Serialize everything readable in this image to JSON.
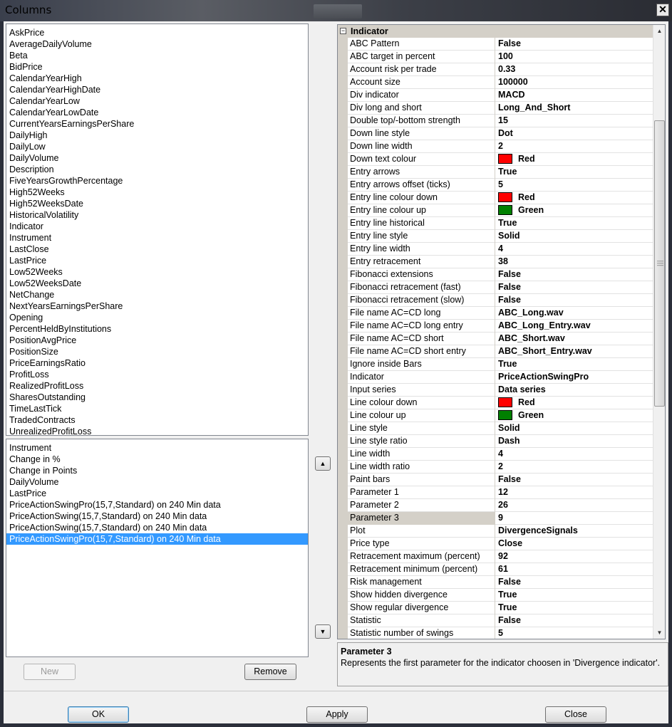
{
  "window": {
    "title": "Columns",
    "close_glyph": "✕"
  },
  "available_columns": [
    "AskPrice",
    "AverageDailyVolume",
    "Beta",
    "BidPrice",
    "CalendarYearHigh",
    "CalendarYearHighDate",
    "CalendarYearLow",
    "CalendarYearLowDate",
    "CurrentYearsEarningsPerShare",
    "DailyHigh",
    "DailyLow",
    "DailyVolume",
    "Description",
    "FiveYearsGrowthPercentage",
    "High52Weeks",
    "High52WeeksDate",
    "HistoricalVolatility",
    "Indicator",
    "Instrument",
    "LastClose",
    "LastPrice",
    "Low52Weeks",
    "Low52WeeksDate",
    "NetChange",
    "NextYearsEarningsPerShare",
    "Opening",
    "PercentHeldByInstitutions",
    "PositionAvgPrice",
    "PositionSize",
    "PriceEarningsRatio",
    "ProfitLoss",
    "RealizedProfitLoss",
    "SharesOutstanding",
    "TimeLastTick",
    "TradedContracts",
    "UnrealizedProfitLoss"
  ],
  "selected_columns": [
    "Instrument",
    "Change in %",
    "Change in Points",
    "DailyVolume",
    "LastPrice",
    "PriceActionSwingPro(15,7,Standard) on 240 Min data",
    "PriceActionSwing(15,7,Standard) on 240 Min data",
    "PriceActionSwing(15,7,Standard) on 240 Min data",
    "PriceActionSwingPro(15,7,Standard) on 240 Min data"
  ],
  "selected_index": 8,
  "buttons": {
    "new": "New",
    "remove": "Remove",
    "ok": "OK",
    "apply": "Apply",
    "close": "Close",
    "move_up": "▲",
    "move_down": "▼"
  },
  "property_grid": {
    "category": "Indicator",
    "collapse_glyph": "−",
    "selected_row": 37,
    "rows": [
      {
        "name": "ABC Pattern",
        "value": "False"
      },
      {
        "name": "ABC target in percent",
        "value": "100"
      },
      {
        "name": "Account risk per trade",
        "value": "0.33"
      },
      {
        "name": "Account size",
        "value": "100000"
      },
      {
        "name": "Div indicator",
        "value": "MACD"
      },
      {
        "name": "Div long and short",
        "value": "Long_And_Short"
      },
      {
        "name": "Double top/-bottom strength",
        "value": "15"
      },
      {
        "name": "Down line style",
        "value": "Dot"
      },
      {
        "name": "Down line width",
        "value": "2"
      },
      {
        "name": "Down text colour",
        "value": "Red",
        "swatch": "#ff0000"
      },
      {
        "name": "Entry arrows",
        "value": "True"
      },
      {
        "name": "Entry arrows offset (ticks)",
        "value": "5"
      },
      {
        "name": "Entry line colour down",
        "value": "Red",
        "swatch": "#ff0000"
      },
      {
        "name": "Entry line colour up",
        "value": "Green",
        "swatch": "#008000"
      },
      {
        "name": "Entry line historical",
        "value": "True"
      },
      {
        "name": "Entry line style",
        "value": "Solid"
      },
      {
        "name": "Entry line width",
        "value": "4"
      },
      {
        "name": "Entry retracement",
        "value": "38"
      },
      {
        "name": "Fibonacci extensions",
        "value": "False"
      },
      {
        "name": "Fibonacci retracement (fast)",
        "value": "False"
      },
      {
        "name": "Fibonacci retracement (slow)",
        "value": "False"
      },
      {
        "name": "File name AC=CD long",
        "value": "ABC_Long.wav"
      },
      {
        "name": "File name AC=CD long entry",
        "value": "ABC_Long_Entry.wav"
      },
      {
        "name": "File name AC=CD short",
        "value": "ABC_Short.wav"
      },
      {
        "name": "File name AC=CD short entry",
        "value": "ABC_Short_Entry.wav"
      },
      {
        "name": "Ignore inside Bars",
        "value": "True"
      },
      {
        "name": "Indicator",
        "value": "PriceActionSwingPro"
      },
      {
        "name": "Input series",
        "value": "Data series"
      },
      {
        "name": "Line colour down",
        "value": "Red",
        "swatch": "#ff0000"
      },
      {
        "name": "Line colour up",
        "value": "Green",
        "swatch": "#008000"
      },
      {
        "name": "Line style",
        "value": "Solid"
      },
      {
        "name": "Line style ratio",
        "value": "Dash"
      },
      {
        "name": "Line width",
        "value": "4"
      },
      {
        "name": "Line width ratio",
        "value": "2"
      },
      {
        "name": "Paint bars",
        "value": "False"
      },
      {
        "name": "Parameter 1",
        "value": "12"
      },
      {
        "name": "Parameter 2",
        "value": "26"
      },
      {
        "name": "Parameter 3",
        "value": "9"
      },
      {
        "name": "Plot",
        "value": "DivergenceSignals"
      },
      {
        "name": "Price type",
        "value": "Close"
      },
      {
        "name": "Retracement maximum (percent)",
        "value": "92"
      },
      {
        "name": "Retracement minimum (percent)",
        "value": "61"
      },
      {
        "name": "Risk management",
        "value": "False"
      },
      {
        "name": "Show hidden divergence",
        "value": "True"
      },
      {
        "name": "Show regular divergence",
        "value": "True"
      },
      {
        "name": "Statistic",
        "value": "False"
      },
      {
        "name": "Statistic number of swings",
        "value": "5"
      }
    ]
  },
  "help": {
    "title": "Parameter 3",
    "description": "Represents the first parameter for the indicator choosen in 'Divergence indicator'."
  }
}
